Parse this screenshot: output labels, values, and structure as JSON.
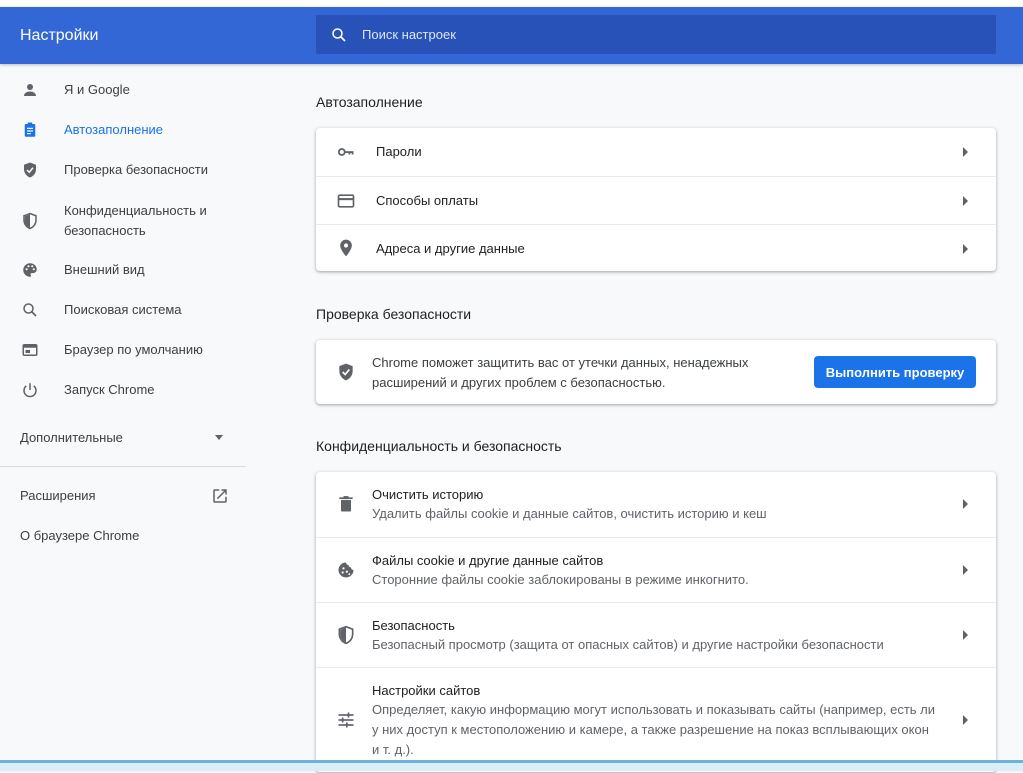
{
  "header": {
    "title": "Настройки",
    "search_placeholder": "Поиск настроек"
  },
  "sidebar": {
    "items": [
      {
        "label": "Я и Google",
        "icon": "person-icon"
      },
      {
        "label": "Автозаполнение",
        "icon": "clipboard-icon",
        "active": true
      },
      {
        "label": "Проверка безопасности",
        "icon": "shield-check-icon"
      },
      {
        "label": "Конфиденциальность и безопасность",
        "icon": "shield-half-icon"
      },
      {
        "label": "Внешний вид",
        "icon": "palette-icon"
      },
      {
        "label": "Поисковая система",
        "icon": "search-icon"
      },
      {
        "label": "Браузер по умолчанию",
        "icon": "browser-icon"
      },
      {
        "label": "Запуск Chrome",
        "icon": "power-icon"
      }
    ],
    "advanced_label": "Дополнительные",
    "extensions_label": "Расширения",
    "about_label": "О браузере Chrome"
  },
  "autofill": {
    "title": "Автозаполнение",
    "rows": [
      {
        "label": "Пароли",
        "icon": "key-icon"
      },
      {
        "label": "Способы оплаты",
        "icon": "credit-card-icon"
      },
      {
        "label": "Адреса и другие данные",
        "icon": "location-pin-icon"
      }
    ]
  },
  "safety": {
    "title": "Проверка безопасности",
    "text_line1": "Chrome поможет защитить вас от утечки данных, ненадежных",
    "text_line2": "расширений и других проблем с безопасностью.",
    "button_label": "Выполнить проверку"
  },
  "privacy": {
    "title": "Конфиденциальность и безопасность",
    "rows": [
      {
        "title": "Очистить историю",
        "subtitle": "Удалить файлы cookie и данные сайтов, очистить историю и кеш",
        "icon": "trash-icon"
      },
      {
        "title": "Файлы cookie и другие данные сайтов",
        "subtitle": "Сторонние файлы cookie заблокированы в режиме инкогнито.",
        "icon": "cookie-icon"
      },
      {
        "title": "Безопасность",
        "subtitle": "Безопасный просмотр (защита от опасных сайтов) и другие настройки безопасности",
        "icon": "shield-half-icon"
      },
      {
        "title": "Настройки сайтов",
        "subtitle_line1": "Определяет, какую информацию могут использовать и показывать сайты (например, есть ли",
        "subtitle_line2": "у них доступ к местоположению и камере, а также разрешение на показ всплывающих окон",
        "subtitle_line3": "и т. д.).",
        "icon": "tune-icon"
      }
    ]
  },
  "colors": {
    "header": "#3367d6",
    "search": "#2852b7",
    "accent": "#1a73e8"
  }
}
